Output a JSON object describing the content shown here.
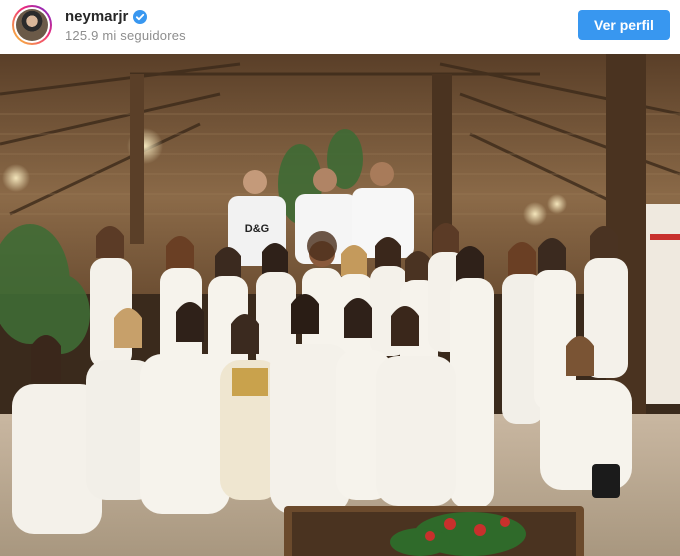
{
  "post": {
    "username": "neymarjr",
    "verified": true,
    "followers": "125.9 mi seguidores",
    "follow_button": "Ver perfil",
    "image_alt_icon": "photo-group-party"
  },
  "colors": {
    "button": "#3897f0",
    "verified_badge": "#3897f0",
    "username": "#262626",
    "secondary_text": "#8e8e8e"
  },
  "photo": {
    "shirt_print": "D&G"
  }
}
